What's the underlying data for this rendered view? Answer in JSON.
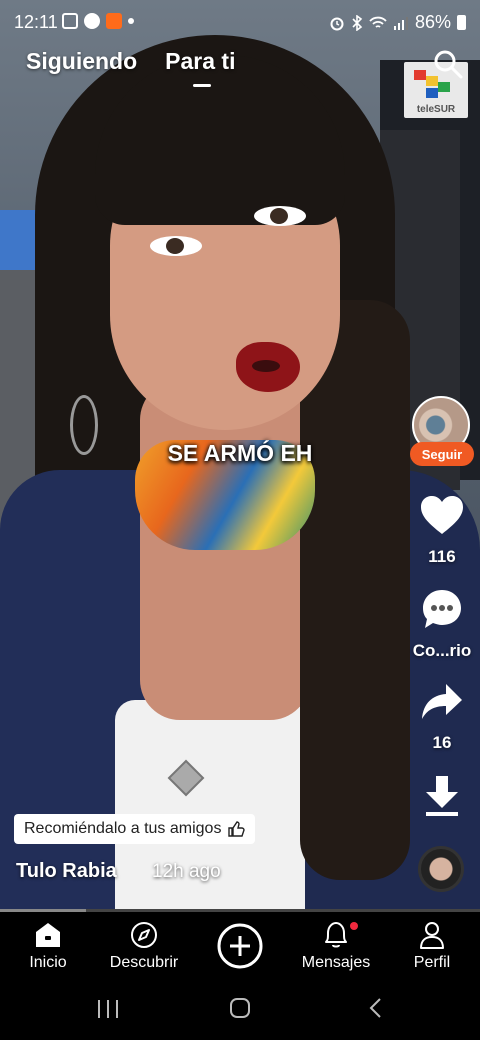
{
  "status_bar": {
    "time": "12:11",
    "battery": "86%"
  },
  "tabs": [
    {
      "label": "Siguiendo",
      "active": false
    },
    {
      "label": "Para ti",
      "active": true
    }
  ],
  "video": {
    "caption": "SE ARMÓ EH",
    "channel_logo_text": "teleSUR",
    "progress": 0.18
  },
  "side_actions": {
    "follow_label": "Seguir",
    "likes": "116",
    "comments_label": "Co...rio",
    "shares": "16"
  },
  "post": {
    "recommend_label": "Recomiéndalo a tus amigos",
    "author": "Tulo Rabia",
    "time_ago": "12h ago"
  },
  "bottom_nav": [
    {
      "label": "Inicio",
      "icon": "home-icon",
      "active": true
    },
    {
      "label": "Descubrir",
      "icon": "compass-icon"
    },
    {
      "label": "",
      "icon": "plus-icon"
    },
    {
      "label": "Mensajes",
      "icon": "bell-icon",
      "has_badge": true
    },
    {
      "label": "Perfil",
      "icon": "person-icon"
    }
  ],
  "colors": {
    "accent": "#f05a23",
    "badge": "#f0293e",
    "background": "#000000"
  }
}
